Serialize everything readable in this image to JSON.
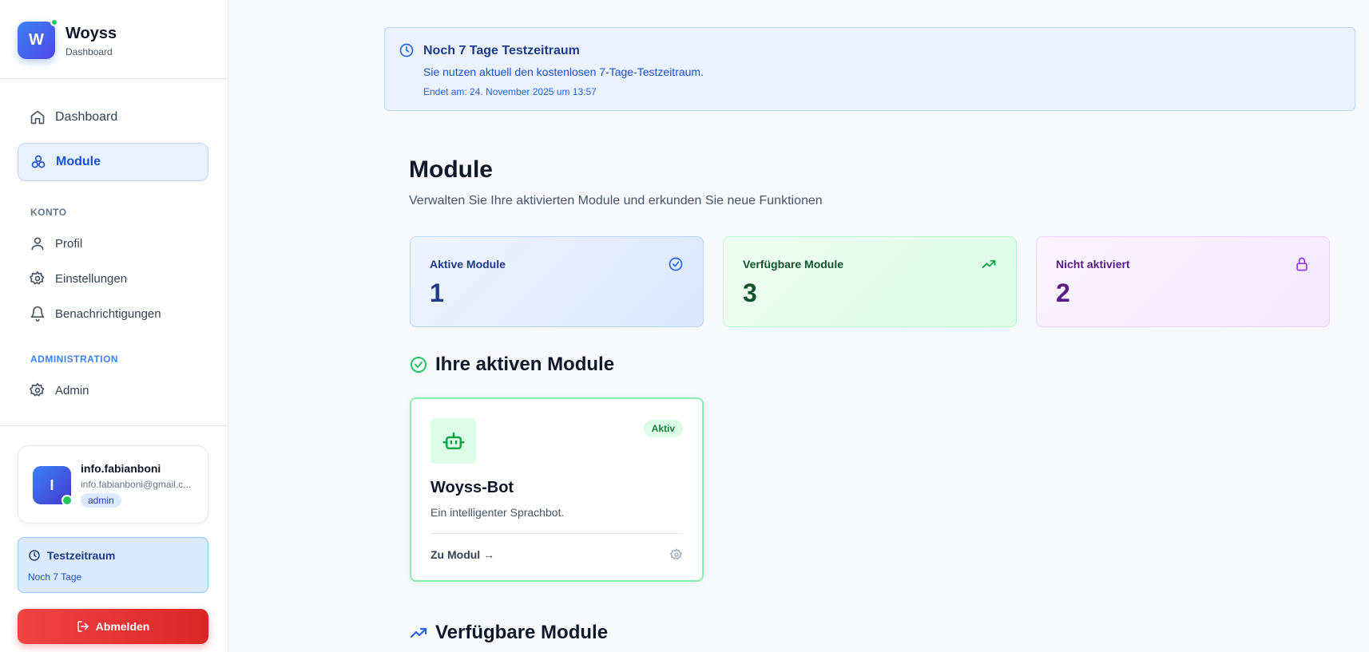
{
  "brand": {
    "logo_letter": "W",
    "name": "Woyss",
    "subtitle": "Dashboard"
  },
  "nav": {
    "dashboard": "Dashboard",
    "module": "Module",
    "konto_label": "KONTO",
    "profil": "Profil",
    "einstellungen": "Einstellungen",
    "benachrichtigungen": "Benachrichtigungen",
    "admin_label": "ADMINISTRATION",
    "admin": "Admin"
  },
  "user": {
    "initial": "I",
    "name": "info.fabianboni",
    "email": "info.fabianboni@gmail.c...",
    "role": "admin"
  },
  "trial_box": {
    "title": "Testzeitraum",
    "subtitle": "Noch 7 Tage"
  },
  "logout_label": "Abmelden",
  "banner": {
    "title": "Noch 7 Tage Testzeitraum",
    "text": "Sie nutzen aktuell den kostenlosen 7-Tage-Testzeitraum.",
    "end": "Endet am: 24. November 2025 um 13:57"
  },
  "page": {
    "title": "Module",
    "subtitle": "Verwalten Sie Ihre aktivierten Module und erkunden Sie neue Funktionen"
  },
  "stats": [
    {
      "label": "Aktive Module",
      "value": "1",
      "icon": "check-circle-icon",
      "color": "#2563eb"
    },
    {
      "label": "Verfügbare Module",
      "value": "3",
      "icon": "trending-up-icon",
      "color": "#16a34a"
    },
    {
      "label": "Nicht aktiviert",
      "value": "2",
      "icon": "lock-icon",
      "color": "#9333ea"
    }
  ],
  "sections": {
    "active": "Ihre aktiven Module",
    "available": "Verfügbare Module"
  },
  "active_module": {
    "badge": "Aktiv",
    "title": "Woyss-Bot",
    "description": "Ein intelligenter Sprachbot.",
    "link": "Zu Modul →",
    "icon": "bot-icon"
  },
  "colors": {
    "accent": "#2563eb",
    "success": "#22c55e",
    "danger": "#dc2626"
  }
}
